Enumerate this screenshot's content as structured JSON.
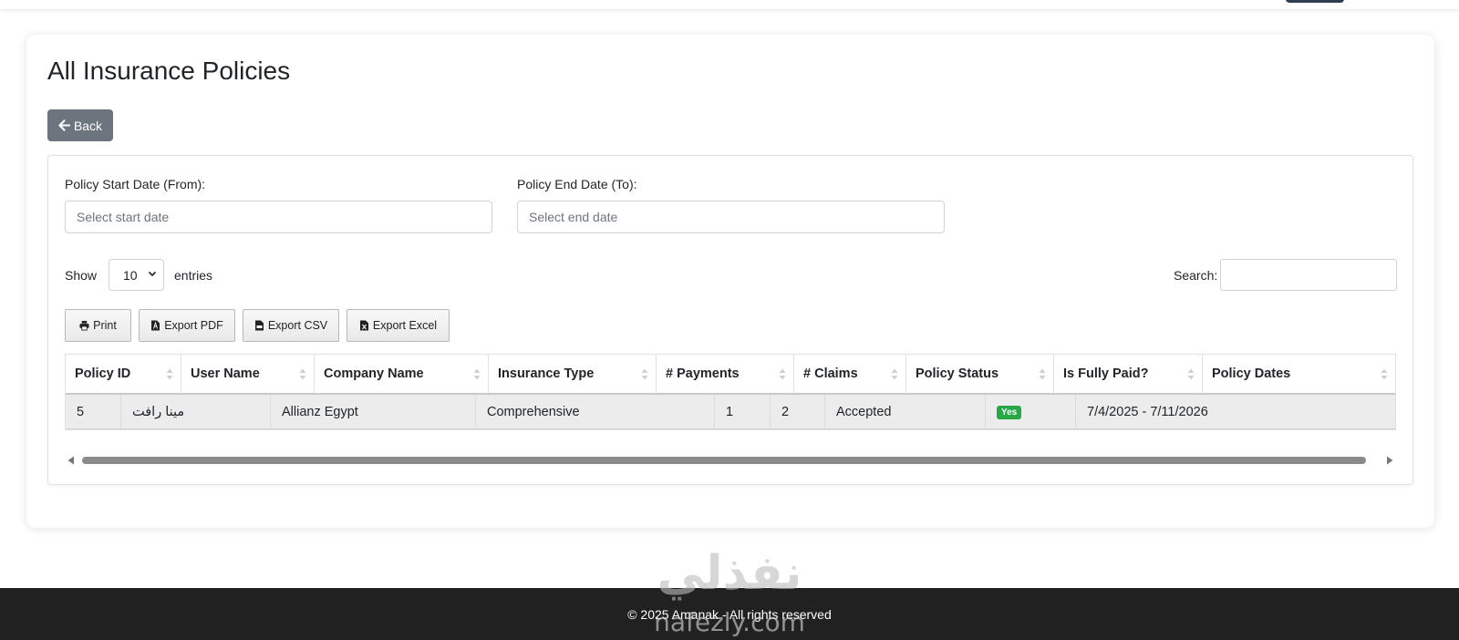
{
  "page": {
    "title": "All Insurance Policies",
    "back_label": "Back"
  },
  "filters": {
    "start_label": "Policy Start Date (From):",
    "start_placeholder": "Select start date",
    "end_label": "Policy End Date (To):",
    "end_placeholder": "Select end date"
  },
  "entries": {
    "show_label": "Show",
    "value": "10",
    "entries_label": "entries",
    "search_label": "Search:"
  },
  "export_buttons": {
    "print": "Print",
    "pdf": "Export PDF",
    "csv": "Export CSV",
    "excel": "Export Excel"
  },
  "table": {
    "headers": [
      "Policy ID",
      "User Name",
      "Company Name",
      "Insurance Type",
      "# Payments",
      "# Claims",
      "Policy Status",
      "Is Fully Paid?",
      "Policy Dates"
    ],
    "rows": [
      {
        "policy_id": "5",
        "user_name": "مينا رافت",
        "company_name": "Allianz Egypt",
        "insurance_type": "Comprehensive",
        "payments": "1",
        "claims": "2",
        "status": "Accepted",
        "fully_paid": "Yes",
        "dates": "7/4/2025 - 7/11/2026"
      }
    ]
  },
  "footer": {
    "text": "© 2025 Amanak - All rights reserved"
  },
  "watermark": {
    "arabic": "نفذلي",
    "latin": "nafezly.com"
  },
  "colors": {
    "back_button": "#6c757d",
    "badge_success": "#28a745",
    "footer_bg": "#212121",
    "row_bg": "#ececec"
  }
}
